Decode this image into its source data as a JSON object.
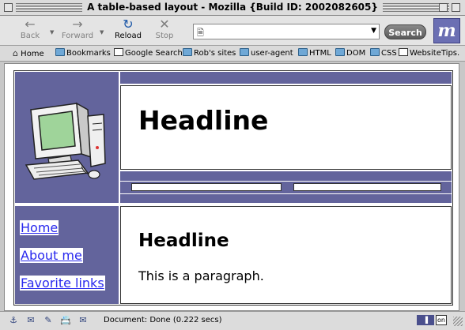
{
  "window": {
    "title": "A table-based layout - Mozilla {Build ID: 2002082605}"
  },
  "toolbar": {
    "back_label": "Back",
    "forward_label": "Forward",
    "reload_label": "Reload",
    "stop_label": "Stop",
    "url_value": "",
    "search_label": "Search"
  },
  "bookmarks": [
    {
      "label": "Home",
      "icon": "home-icon"
    },
    {
      "label": "Bookmarks",
      "icon": "folder-icon"
    },
    {
      "label": "Google Search",
      "icon": "page-icon"
    },
    {
      "label": "Rob's sites",
      "icon": "folder-icon"
    },
    {
      "label": "user-agent",
      "icon": "folder-icon"
    },
    {
      "label": "HTML",
      "icon": "folder-icon"
    },
    {
      "label": "DOM",
      "icon": "folder-icon"
    },
    {
      "label": "CSS",
      "icon": "folder-icon"
    },
    {
      "label": "WebsiteTips.",
      "icon": "page-icon"
    }
  ],
  "page": {
    "headline": "Headline",
    "sub_headline": "Headline",
    "paragraph": "This is a paragraph.",
    "nav": [
      {
        "label": "Home"
      },
      {
        "label": "About me"
      },
      {
        "label": "Favorite links"
      }
    ]
  },
  "status": {
    "text": "Document: Done (0.222 secs)",
    "online_badge": "on"
  },
  "colors": {
    "layout_purple": "#63649c",
    "link_blue": "#2828ee"
  }
}
